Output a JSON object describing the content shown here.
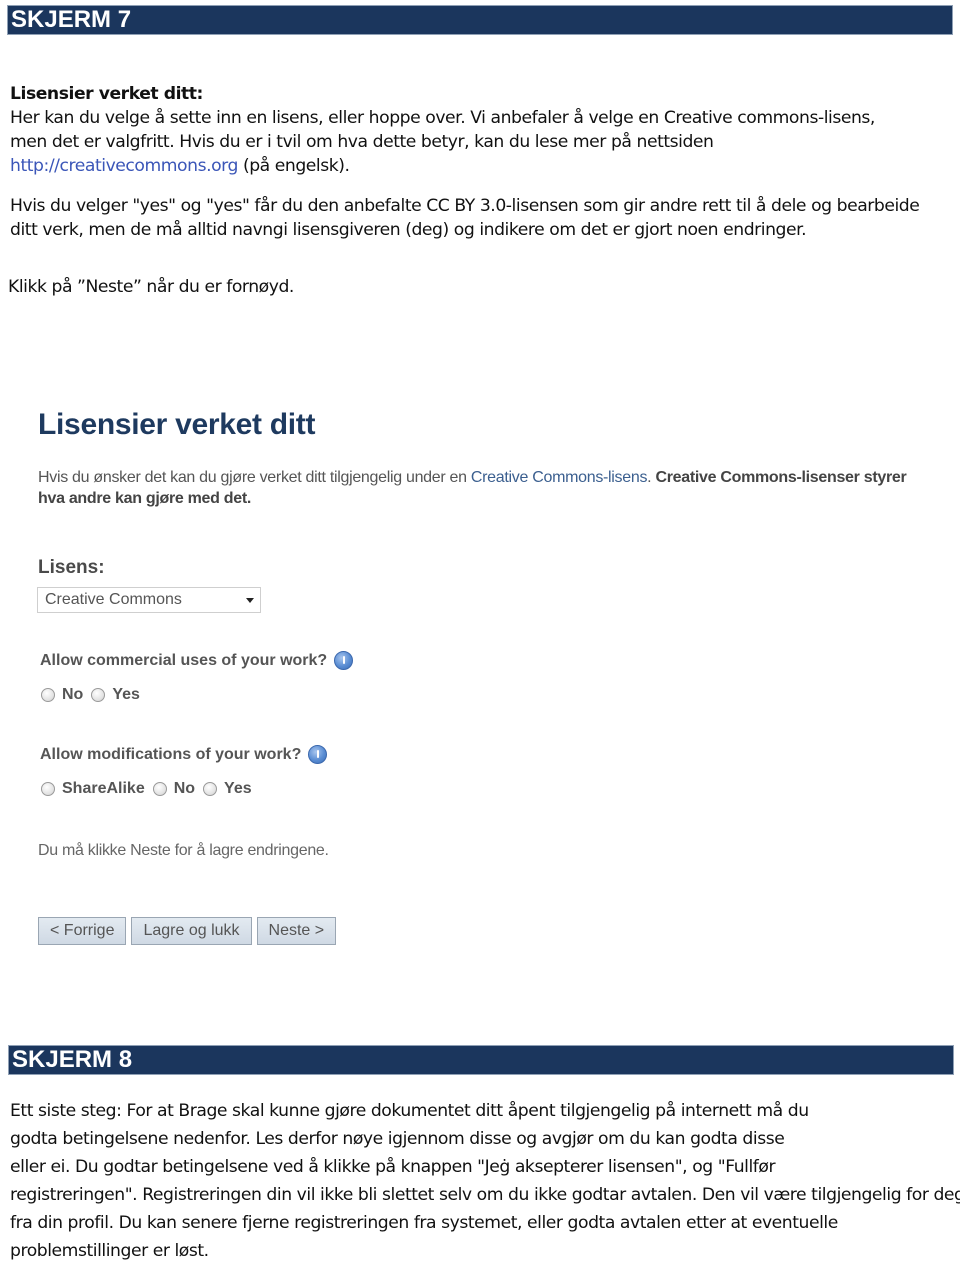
{
  "screen7": {
    "header": "SKJERM 7",
    "intro_title": "Lisensier verket ditt:",
    "intro_lines": [
      "Her kan du velge å sette inn en lisens, eller hoppe over. Vi anbefaler å velge en Creative commons-lisens,",
      "men det er valgfritt. Hvis du er i tvil om hva dette betyr, kan du lese mer på nettsiden"
    ],
    "link_text": "http://creativecommons.org",
    "link_suffix": " (på engelsk).",
    "cc_note_lines": [
      "Hvis du velger \"yes\" og \"yes\" får du den anbefalte CC BY 3.0-lisensen som gir andre rett til å dele og  bearbeide",
      "ditt verk, men de må alltid navngi lisensgiveren (deg) og indikere om det er gjort noen  endringer."
    ],
    "click_next": "Klikk på ”Neste” når du er fornøyd.",
    "form": {
      "title": "Lisensier verket ditt",
      "desc_prefix": "Hvis du ønsker det kan du gjøre verket ditt tilgjengelig under en ",
      "desc_link": "Creative Commons-lisens",
      "desc_mid": ". ",
      "desc_bold": "Creative Commons-lisenser styrer hva andre kan gjøre med det.",
      "license_label": "Lisens:",
      "license_selected": "Creative Commons",
      "question_commercial": "Allow commercial uses of your work?",
      "commercial_options": [
        "No",
        "Yes"
      ],
      "question_modifications": "Allow modifications of your work?",
      "modification_options": [
        "ShareAlike",
        "No",
        "Yes"
      ],
      "save_hint": "Du må klikke Neste for å lagre endringene.",
      "buttons": {
        "previous": "< Forrige",
        "save_close": "Lagre og lukk",
        "next": "Neste >"
      }
    }
  },
  "screen8": {
    "header": "SKJERM 8",
    "lines": [
      "Ett siste steg: For at Brage skal kunne gjøre dokumentet ditt åpent tilgjengelig på internett  må  du",
      "godta  betingelsene  nedenfor.  Les  derfor  nøye  igjennom  disse  og  avgjør  om  du  kan  godta disse",
      "eller ei. Du  godtar  betingelsene ved  å klikke på knappen \"Jeġ aksepterer  lisensen\",  og  \"Fullfør",
      "registreringen\". Registreringen din vil ikke bli slettet selv om du ikke godtar avtalen. Den vil være tilgjengelig for deg",
      "fra din profil. Du kan senere fjerne registreringen fra systemet, eller godta avtalen etter at  eventuelle",
      "problemstillinger er løst."
    ]
  },
  "colors": {
    "header_bg": "#1b365d",
    "link": "#3b56b8",
    "form_title": "#1e3a5f"
  }
}
